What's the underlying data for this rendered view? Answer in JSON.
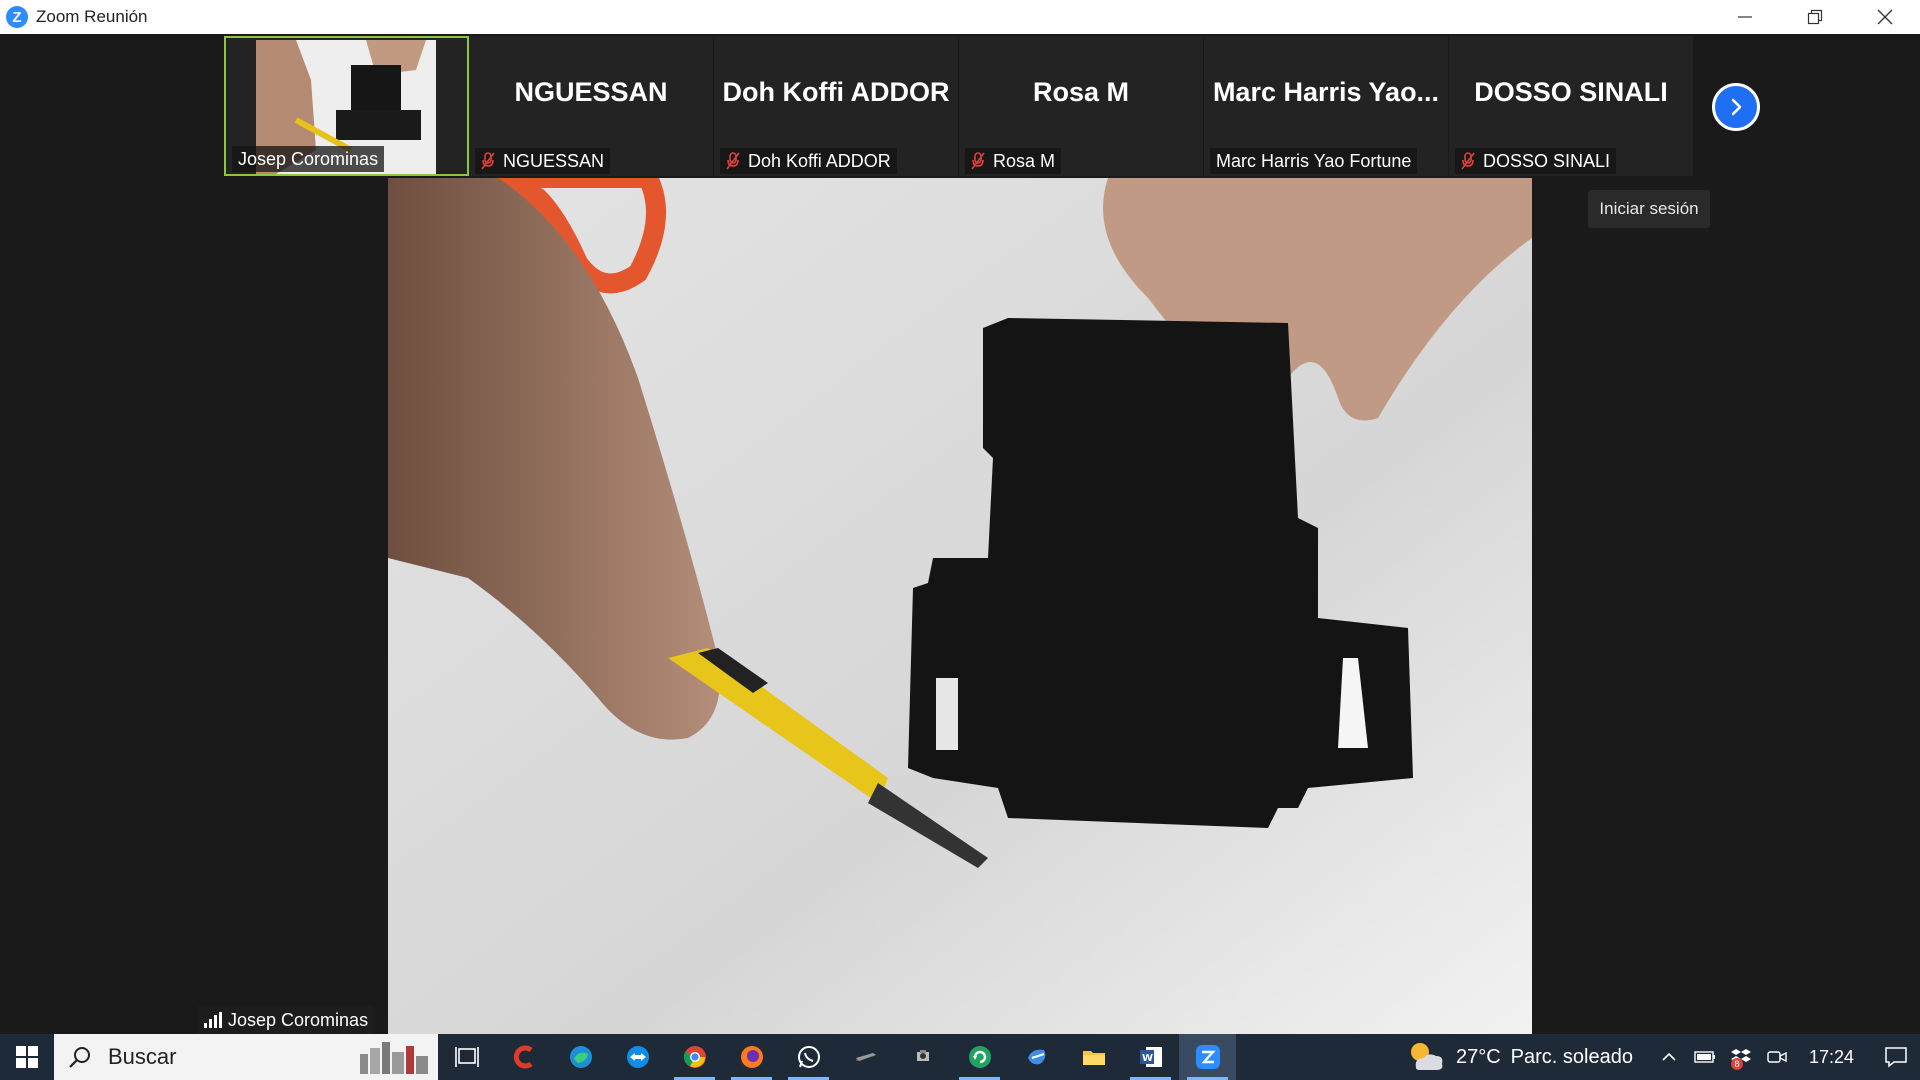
{
  "window": {
    "title": "Zoom Reunión",
    "logo_letter": "Z"
  },
  "strip": {
    "tiles": [
      {
        "label": "Josep Corominas",
        "big_name": "",
        "muted": false,
        "video": true
      },
      {
        "label": "NGUESSAN",
        "big_name": "NGUESSAN",
        "muted": true,
        "video": false
      },
      {
        "label": "Doh Koffi ADDOR",
        "big_name": "Doh Koffi ADDOR",
        "muted": true,
        "video": false
      },
      {
        "label": "Rosa M",
        "big_name": "Rosa M",
        "muted": true,
        "video": false
      },
      {
        "label": "Marc Harris Yao Fortune",
        "big_name": "Marc  Harris  Yao...",
        "muted": false,
        "video": false
      },
      {
        "label": "DOSSO SINALI",
        "big_name": "DOSSO SINALI",
        "muted": true,
        "video": false
      }
    ]
  },
  "signin_label": "Iniciar sesión",
  "active_speaker": "Josep Corominas",
  "taskbar": {
    "search_placeholder": "Buscar",
    "weather_temp": "27°C",
    "weather_desc": "Parc. soleado",
    "time": "17:24",
    "notification_badge": "8"
  },
  "colors": {
    "zoom_blue": "#2d8cff",
    "active_border": "#8cc63f",
    "muted_red": "#e0403a",
    "taskbar_bg": "#1f2a38"
  }
}
